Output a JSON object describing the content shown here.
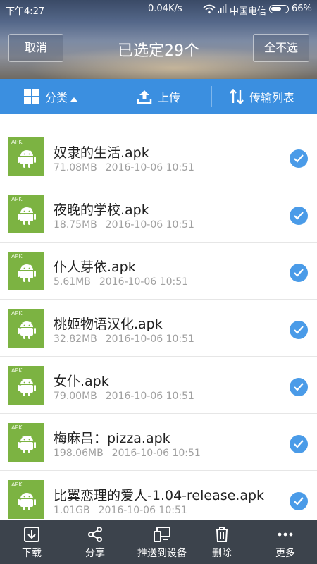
{
  "status": {
    "time": "下午4:27",
    "speed": "0.04K/s",
    "carrier": "中国电信",
    "battery": "66%",
    "battery_level": 0.66
  },
  "header": {
    "cancel_label": "取消",
    "title": "已选定29个",
    "deselect_label": "全不选"
  },
  "toolbar": {
    "category_label": "分类",
    "upload_label": "上传",
    "transfer_label": "传输列表"
  },
  "files": [
    {
      "name": "奴隶的生活.apk",
      "size": "71.08MB",
      "date": "2016-10-06  10:51"
    },
    {
      "name": "夜晚的学校.apk",
      "size": "18.75MB",
      "date": "2016-10-06  10:51"
    },
    {
      "name": "仆人芽依.apk",
      "size": "5.61MB",
      "date": "2016-10-06  10:51"
    },
    {
      "name": "桃姬物语汉化.apk",
      "size": "32.82MB",
      "date": "2016-10-06  10:51"
    },
    {
      "name": "女仆.apk",
      "size": "79.00MB",
      "date": "2016-10-06  10:51"
    },
    {
      "name": "梅麻吕：pizza.apk",
      "size": "198.06MB",
      "date": "2016-10-06  10:51"
    },
    {
      "name": "比翼恋理的爱人-1.04-release.apk",
      "size": "1.01GB",
      "date": "2016-10-06  10:51"
    }
  ],
  "apk_badge": "APK",
  "bottom_bar": {
    "download_label": "下载",
    "share_label": "分享",
    "push_label": "推送到设备",
    "delete_label": "删除",
    "more_label": "更多"
  },
  "colors": {
    "accent": "#3b8fe0",
    "apk_green": "#7cb342",
    "check_blue": "#4a9be8",
    "bottom_bar": "#3c434c"
  }
}
